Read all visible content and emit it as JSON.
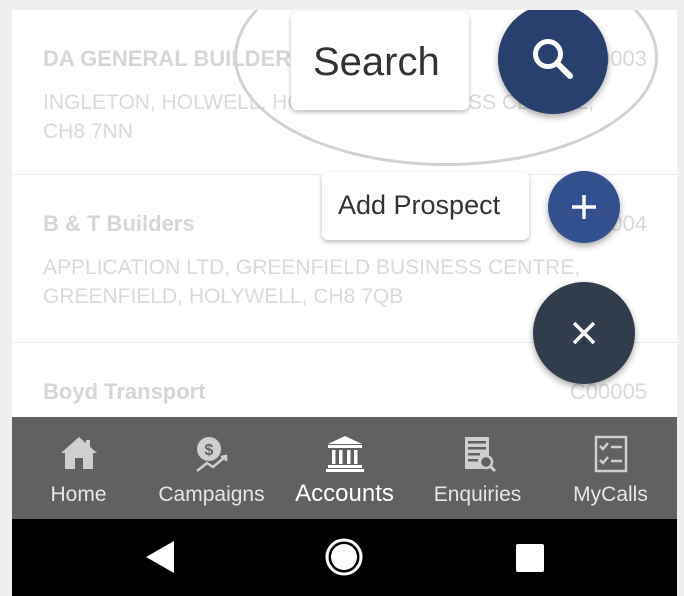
{
  "accounts": [
    {
      "name": "DA GENERAL BUILDERS",
      "code": "C00003",
      "address_line1": "INGLETON, HOLWELL, HOLYWELL BUSINESS CENTRE,",
      "address_line2": "CH8 7NN"
    },
    {
      "name": "B & T Builders",
      "code": "C00004",
      "address_line1": "APPLICATION LTD, GREENFIELD BUSINESS CENTRE,",
      "address_line2": "GREENFIELD, HOLYWELL, CH8 7QB"
    },
    {
      "name": "Boyd Transport",
      "code": "C00005"
    }
  ],
  "fab_menu": {
    "search_label": "Search",
    "add_prospect_label": "Add Prospect",
    "search_icon": "search-icon",
    "add_icon": "plus-icon",
    "close_icon": "close-icon"
  },
  "nav": {
    "items": [
      {
        "label": "Home",
        "icon": "home-icon"
      },
      {
        "label": "Campaigns",
        "icon": "campaigns-icon"
      },
      {
        "label": "Accounts",
        "icon": "bank-icon",
        "active": true
      },
      {
        "label": "Enquiries",
        "icon": "enquiries-icon"
      },
      {
        "label": "MyCalls",
        "icon": "checklist-icon"
      }
    ]
  },
  "colors": {
    "nav_background": "#616161",
    "fab_search": "#29406e",
    "fab_add": "#33518e",
    "fab_close": "#313d4c"
  }
}
